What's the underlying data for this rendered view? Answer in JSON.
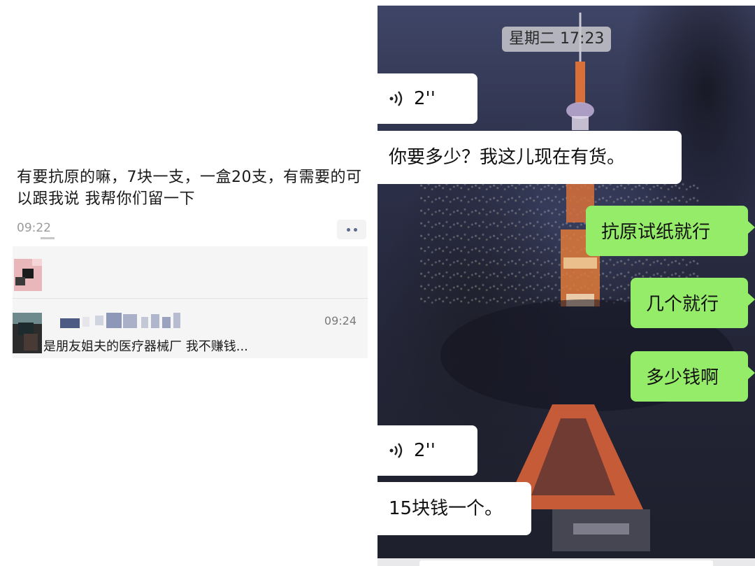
{
  "moments_post": {
    "text": "有要抗原的嘛，7块一支，一盒20支，有需要的可以跟我说 我帮你们留一下",
    "time": "09:22",
    "comment": {
      "time": "09:24",
      "text": "是朋友姐夫的医疗器械厂 我不赚钱..."
    }
  },
  "chat": {
    "timestamp": "星期二 17:23",
    "messages": [
      {
        "side": "incoming",
        "type": "voice",
        "duration": "2''"
      },
      {
        "side": "incoming",
        "type": "text",
        "text": "你要多少？我这儿现在有货。"
      },
      {
        "side": "outgoing",
        "type": "text",
        "text": "抗原试纸就行"
      },
      {
        "side": "outgoing",
        "type": "text",
        "text": "几个就行"
      },
      {
        "side": "outgoing",
        "type": "text",
        "text": "多少钱啊"
      },
      {
        "side": "incoming",
        "type": "voice",
        "duration": "2''"
      },
      {
        "side": "incoming",
        "type": "text",
        "text": "15块钱一个。"
      }
    ]
  },
  "colors": {
    "outgoing_bubble": "#95ec69",
    "incoming_bubble": "#ffffff",
    "link_blue": "#5a6b8f"
  },
  "icons": {
    "voice": "voice-wave-icon",
    "more": "more-dots-icon"
  }
}
